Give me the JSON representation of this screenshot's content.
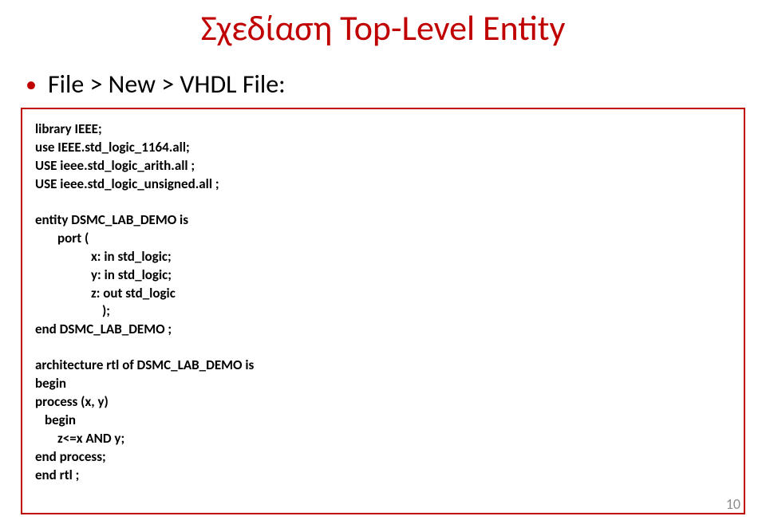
{
  "title": "Σχεδίαση Top-Level Entity",
  "bullet_text": "File > New > VHDL File:",
  "code": {
    "l1": "library IEEE;",
    "l2": "use IEEE.std_logic_1164.all;",
    "l3": "USE ieee.std_logic_arith.all ;",
    "l4": "USE ieee.std_logic_unsigned.all ;",
    "l5": "entity DSMC_LAB_DEMO is",
    "l6": "port (",
    "l7": "x: in std_logic;",
    "l8": "y: in std_logic;",
    "l9": "z: out std_logic",
    "l10": ");",
    "l11": "end DSMC_LAB_DEMO ;",
    "l12": "architecture rtl of DSMC_LAB_DEMO is",
    "l13": "begin",
    "l14": "process (x, y)",
    "l15": "begin",
    "l16": "z<=x AND y;",
    "l17": "end process;",
    "l18": "end rtl ;"
  },
  "page_number": "10"
}
